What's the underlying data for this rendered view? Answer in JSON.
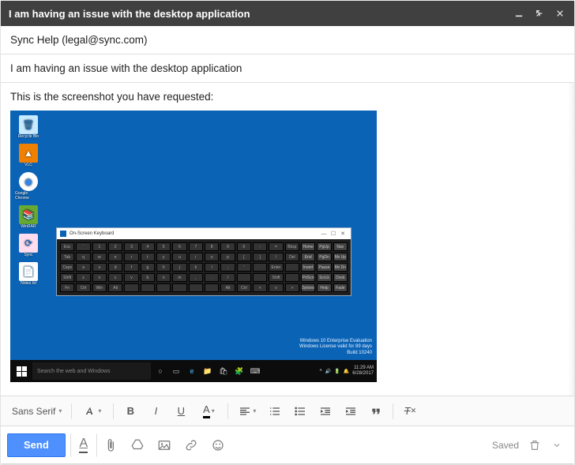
{
  "window": {
    "title": "I am having an issue with the desktop application"
  },
  "fields": {
    "to": "Sync Help (legal@sync.com)",
    "subject": "I am having an issue with the desktop application"
  },
  "body": {
    "intro": "This is the screenshot you have requested:"
  },
  "screenshot": {
    "icons": [
      {
        "label": "Recycle Bin"
      },
      {
        "label": "VLC"
      },
      {
        "label": "Google Chrome"
      },
      {
        "label": "WinRAR"
      },
      {
        "label": "Sync"
      },
      {
        "label": "Notes.txt"
      }
    ],
    "osk": {
      "title": "On-Screen Keyboard",
      "keys_row1": [
        "Esc",
        "`",
        "1",
        "2",
        "3",
        "4",
        "5",
        "6",
        "7",
        "8",
        "9",
        "0",
        "-",
        "=",
        "Bksp",
        "Home",
        "PgUp",
        "Nav"
      ],
      "keys_row2": [
        "Tab",
        "q",
        "w",
        "e",
        "r",
        "t",
        "y",
        "u",
        "i",
        "o",
        "p",
        "[",
        "]",
        "\\",
        "Del",
        "End",
        "PgDn",
        "Mv Up"
      ],
      "keys_row3": [
        "Caps",
        "a",
        "s",
        "d",
        "f",
        "g",
        "h",
        "j",
        "k",
        "l",
        ";",
        "'",
        "",
        "Enter",
        "",
        "Insert",
        "Pause",
        "Mv Dn"
      ],
      "keys_row4": [
        "Shift",
        "z",
        "x",
        "c",
        "v",
        "b",
        "n",
        "m",
        ",",
        ".",
        "/",
        "",
        "",
        "Shift",
        "",
        "PrtScn",
        "ScrLk",
        "Dock"
      ],
      "keys_row5": [
        "Fn",
        "Ctrl",
        "Win",
        "Alt",
        "",
        "",
        "",
        "",
        "",
        "",
        "Alt",
        "Ctrl",
        "<",
        "v",
        ">",
        "Options",
        "Help",
        "Fade"
      ]
    },
    "watermark": {
      "l1": "Windows 10 Enterprise Evaluation",
      "l2": "Windows License valid for 89 days",
      "l3": "Build 10240"
    },
    "taskbar": {
      "search_placeholder": "Search the web and Windows",
      "time": "11:29 AM",
      "date": "6/28/2017"
    }
  },
  "format_toolbar": {
    "font": "Sans Serif"
  },
  "actions": {
    "send_label": "Send",
    "saved_label": "Saved"
  }
}
